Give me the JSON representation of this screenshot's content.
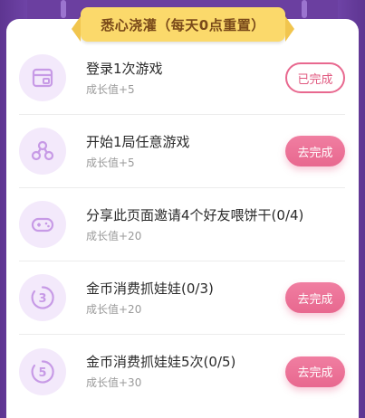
{
  "section": {
    "title": "悉心浇灌（每天0点重置）"
  },
  "tasks": [
    {
      "icon": "ticket-icon",
      "title": "登录1次游戏",
      "reward": "成长值+5",
      "button": "已完成",
      "status": "done"
    },
    {
      "icon": "tree-icon",
      "title": "开始1局任意游戏",
      "reward": "成长值+5",
      "button": "去完成",
      "status": "todo"
    },
    {
      "icon": "gamepad-icon",
      "title": "分享此页面邀请4个好友喂饼干(0/4)",
      "reward": "成长值+20",
      "button": "",
      "status": "none"
    },
    {
      "icon": "number-3-icon",
      "title": "金币消费抓娃娃(0/3)",
      "reward": "成长值+20",
      "button": "去完成",
      "status": "todo"
    },
    {
      "icon": "number-5-icon",
      "title": "金币消费抓娃娃5次(0/5)",
      "reward": "成长值+30",
      "button": "去完成",
      "status": "todo"
    }
  ],
  "colors": {
    "accent": "#e8688f",
    "icon": "#c79ae6",
    "iconBg": "#f3e9fb",
    "banner": "#fbd96b",
    "bg": "#6b3fa0"
  }
}
